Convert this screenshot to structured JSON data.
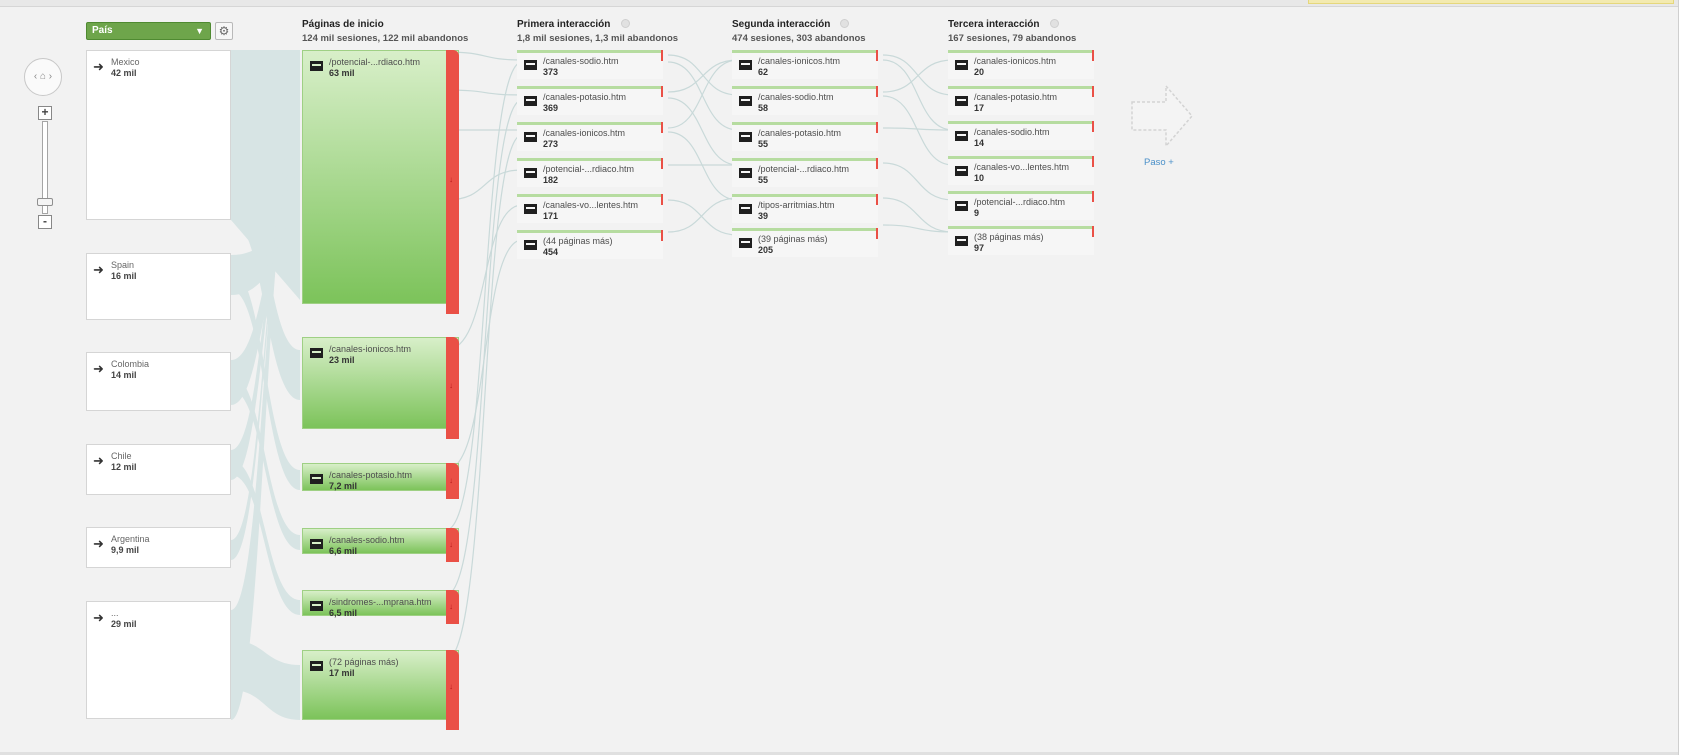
{
  "dimension": {
    "label": "País",
    "dropdown_icon": "chevron-down-icon",
    "settings_icon": "gear-icon"
  },
  "columns": [
    {
      "title": "Páginas de inicio",
      "subtitle": "124 mil sesiones, 122 mil abandonos"
    },
    {
      "title": "Primera interacción",
      "subtitle": "1,8 mil sesiones, 1,3 mil abandonos"
    },
    {
      "title": "Segunda interacción",
      "subtitle": "474 sesiones, 303 abandonos"
    },
    {
      "title": "Tercera interacción",
      "subtitle": "167 sesiones, 79 abandonos"
    }
  ],
  "countries": [
    {
      "name": "Mexico",
      "value": "42 mil"
    },
    {
      "name": "Spain",
      "value": "16 mil"
    },
    {
      "name": "Colombia",
      "value": "14 mil"
    },
    {
      "name": "Chile",
      "value": "12 mil"
    },
    {
      "name": "Argentina",
      "value": "9,9 mil"
    },
    {
      "name": "...",
      "value": "29 mil"
    }
  ],
  "start_pages": [
    {
      "page": "/potencial-...rdiaco.htm",
      "value": "63 mil"
    },
    {
      "page": "/canales-ionicos.htm",
      "value": "23 mil"
    },
    {
      "page": "/canales-potasio.htm",
      "value": "7,2 mil"
    },
    {
      "page": "/canales-sodio.htm",
      "value": "6,6 mil"
    },
    {
      "page": "/sindromes-...mprana.htm",
      "value": "6,5 mil"
    },
    {
      "page": "(72 páginas más)",
      "value": "17 mil"
    }
  ],
  "first_interaction": [
    {
      "page": "/canales-sodio.htm",
      "value": "373"
    },
    {
      "page": "/canales-potasio.htm",
      "value": "369"
    },
    {
      "page": "/canales-ionicos.htm",
      "value": "273"
    },
    {
      "page": "/potencial-...rdiaco.htm",
      "value": "182"
    },
    {
      "page": "/canales-vo...lentes.htm",
      "value": "171"
    },
    {
      "page": "(44 páginas más)",
      "value": "454"
    }
  ],
  "second_interaction": [
    {
      "page": "/canales-ionicos.htm",
      "value": "62"
    },
    {
      "page": "/canales-sodio.htm",
      "value": "58"
    },
    {
      "page": "/canales-potasio.htm",
      "value": "55"
    },
    {
      "page": "/potencial-...rdiaco.htm",
      "value": "55"
    },
    {
      "page": "/tipos-arritmias.htm",
      "value": "39"
    },
    {
      "page": "(39 páginas más)",
      "value": "205"
    }
  ],
  "third_interaction": [
    {
      "page": "/canales-ionicos.htm",
      "value": "20"
    },
    {
      "page": "/canales-potasio.htm",
      "value": "17"
    },
    {
      "page": "/canales-sodio.htm",
      "value": "14"
    },
    {
      "page": "/canales-vo...lentes.htm",
      "value": "10"
    },
    {
      "page": "/potencial-...rdiaco.htm",
      "value": "9"
    },
    {
      "page": "(38 páginas más)",
      "value": "97"
    }
  ],
  "step_button": {
    "label": "Paso +"
  },
  "controls": {
    "zoom_in": "+",
    "zoom_out": "-",
    "home_icon": "home-icon",
    "prev_icon": "chevron-left-icon",
    "next_icon": "chevron-right-icon"
  },
  "colors": {
    "node_green": "#7cc35a",
    "dropoff_red": "#ea5046",
    "link_blue": "#4a90c9",
    "flow_gray": "#cfdede"
  }
}
